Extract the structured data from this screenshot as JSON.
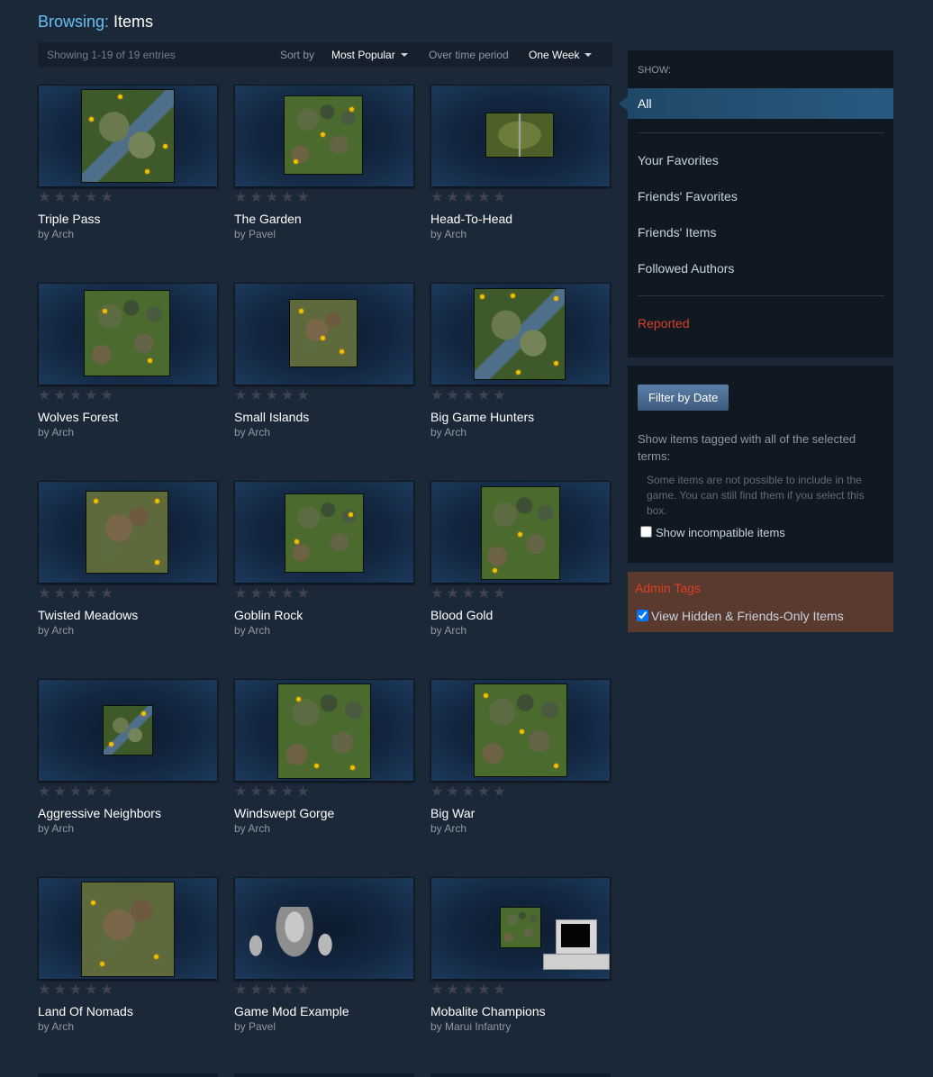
{
  "header": {
    "prefix": "Browsing:",
    "title": "Items"
  },
  "sortbar": {
    "count_text": "Showing 1-19 of 19 entries",
    "sort_label": "Sort by",
    "sort_value": "Most Popular",
    "period_label": "Over time period",
    "period_value": "One Week"
  },
  "items": [
    {
      "name": "Triple Pass",
      "by": "by Arch",
      "stars": "★★★★★"
    },
    {
      "name": "The Garden",
      "by": "by Pavel",
      "stars": "★★★★★"
    },
    {
      "name": "Head-To-Head",
      "by": "by Arch",
      "stars": "★★★★★"
    },
    {
      "name": "Wolves Forest",
      "by": "by Arch",
      "stars": "★★★★★"
    },
    {
      "name": "Small Islands",
      "by": "by Arch",
      "stars": "★★★★★"
    },
    {
      "name": "Big Game Hunters",
      "by": "by Arch",
      "stars": "★★★★★"
    },
    {
      "name": "Twisted Meadows",
      "by": "by Arch",
      "stars": "★★★★★"
    },
    {
      "name": "Goblin Rock",
      "by": "by Arch",
      "stars": "★★★★★"
    },
    {
      "name": "Blood Gold",
      "by": "by Arch",
      "stars": "★★★★★"
    },
    {
      "name": "Aggressive Neighbors",
      "by": "by Arch",
      "stars": "★★★★★"
    },
    {
      "name": "Windswept Gorge",
      "by": "by Arch",
      "stars": "★★★★★"
    },
    {
      "name": "Big War",
      "by": "by Arch",
      "stars": "★★★★★"
    },
    {
      "name": "Land Of Nomads",
      "by": "by Arch",
      "stars": "★★★★★"
    },
    {
      "name": "Game Mod Example",
      "by": "by Pavel",
      "stars": "★★★★★"
    },
    {
      "name": "Mobalite Champions",
      "by": "by Marui Infantry",
      "stars": "★★★★★"
    }
  ],
  "show": {
    "label": "SHOW:",
    "all": "All",
    "your_favorites": "Your Favorites",
    "friends_favorites": "Friends' Favorites",
    "friends_items": "Friends' Items",
    "followed_authors": "Followed Authors",
    "reported": "Reported"
  },
  "filter": {
    "button": "Filter by Date",
    "description": "Show items tagged with all of the selected terms:",
    "incompat_note": "Some items are not possible to include in the game. You can still find them if you select this box.",
    "incompat_label": "Show incompatible items"
  },
  "admin": {
    "title": "Admin Tags",
    "hidden_label": "View Hidden & Friends-Only Items"
  },
  "colors": {
    "background": "#1b2838",
    "accent": "#66c0f4",
    "reported": "#d94126",
    "admin_bg": "#5a3a2e"
  }
}
